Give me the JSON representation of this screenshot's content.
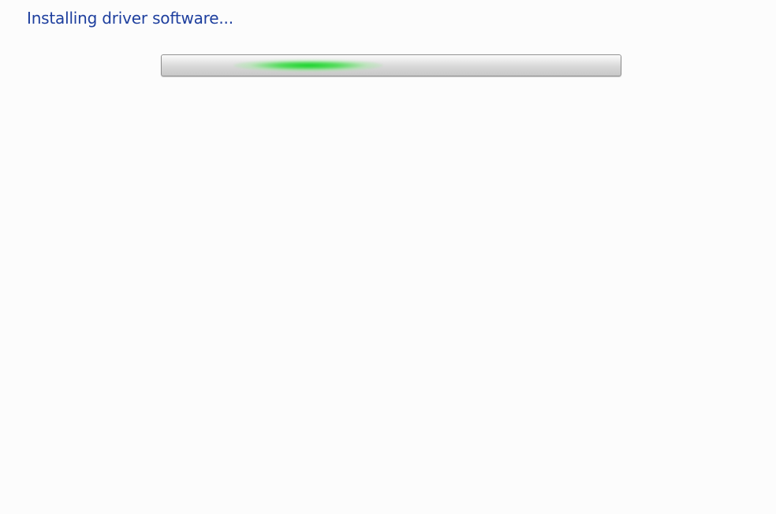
{
  "dialog": {
    "heading": "Installing driver software..."
  },
  "progress": {
    "mode": "indeterminate",
    "marquee_color": "#14d228",
    "marquee_position_fraction": 0.32
  },
  "colors": {
    "heading_text": "#1e3f9e",
    "background": "#fcfcfc"
  }
}
